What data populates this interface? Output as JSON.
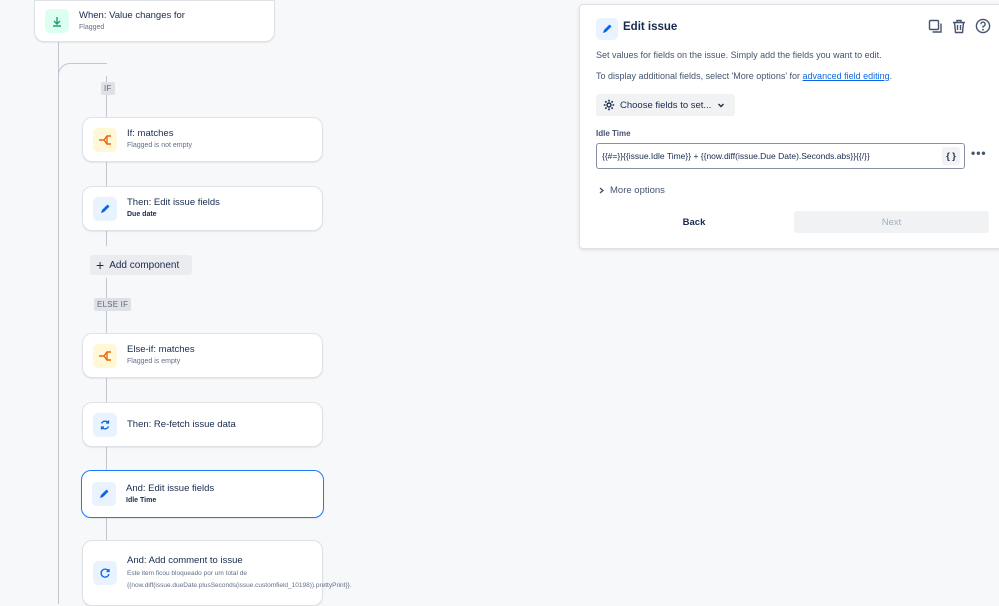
{
  "flow": {
    "trigger": {
      "title": "When: Value changes for",
      "sub": "Flagged"
    },
    "if_tag": "IF",
    "if_condition": {
      "title": "If: matches",
      "sub": "Flagged is not empty"
    },
    "then_edit": {
      "title": "Then: Edit issue fields",
      "sub": "Due date"
    },
    "add_component": "Add component",
    "else_if_tag": "ELSE IF",
    "else_if_condition": {
      "title": "Else-if: matches",
      "sub": "Flagged is empty"
    },
    "then_refetch": {
      "title": "Then: Re-fetch issue data"
    },
    "and_edit": {
      "title": "And: Edit issue fields",
      "sub": "Idle Time"
    },
    "and_comment": {
      "title": "And: Add comment to issue",
      "sub": "Este item ficou bloqueado por um total de {{now.diff(issue.dueDate.plusSeconds(issue.customfield_10198)).prettyPrint}}."
    }
  },
  "panel": {
    "title": "Edit issue",
    "desc1": "Set values for fields on the issue. Simply add the fields you want to edit.",
    "desc2_prefix": "To display additional fields, select 'More options' for ",
    "desc2_link": "advanced field editing",
    "desc2_suffix": ".",
    "choose_fields": "Choose fields to set...",
    "field_label": "Idle Time",
    "field_value": "{{#=}}{{issue.Idle Time}} + {{now.diff(issue.Due Date).Seconds.abs}}{{/}}",
    "smart_value_btn": "{ }",
    "more_dots": "•••",
    "more_options": "More options",
    "back": "Back",
    "next": "Next"
  },
  "icons": {
    "trigger": "trigger-down-arrow-icon",
    "condition": "branch-condition-icon",
    "edit": "pencil-icon",
    "refetch": "refresh-icon",
    "comment": "comment-refresh-icon",
    "duplicate": "duplicate-icon",
    "delete": "trash-icon",
    "help": "help-icon",
    "gear": "gear-icon"
  },
  "colors": {
    "accent": "#0c66e4",
    "selected_border": "#1d7afc",
    "condition_icon_bg": "#fff7d6",
    "trigger_icon_bg": "#dcfff1"
  }
}
